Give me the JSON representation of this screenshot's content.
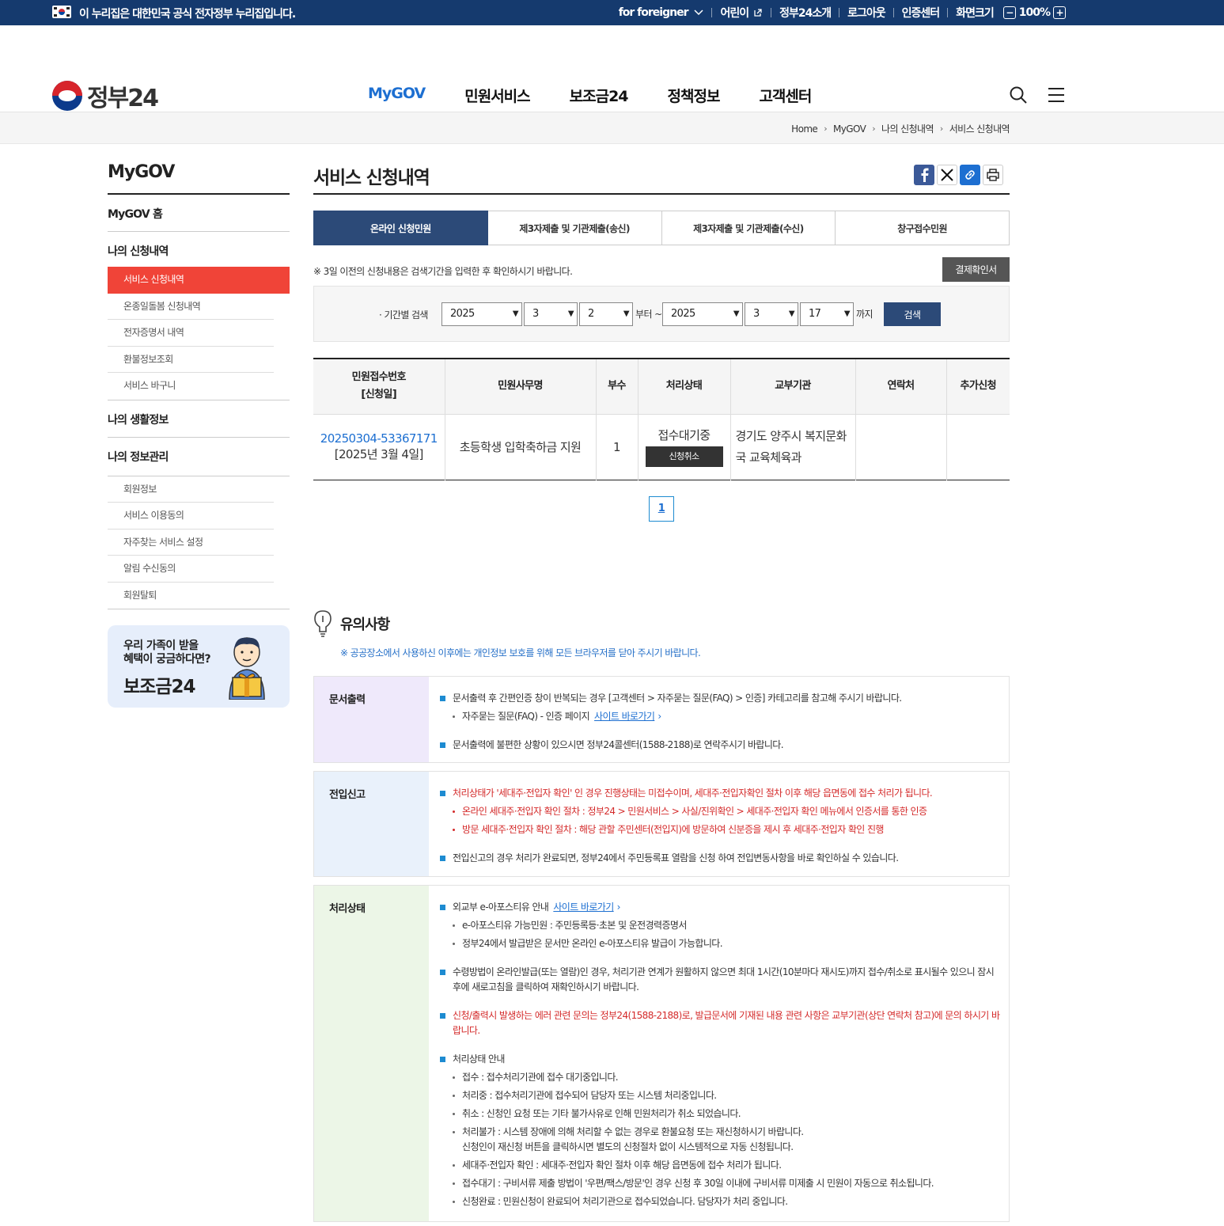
{
  "govbar": {
    "notice": "이 누리집은 대한민국 공식 전자정부 누리집입니다.",
    "foreigner": "for foreigner",
    "links": [
      "어린이",
      "정부24소개",
      "로그아웃",
      "인증센터"
    ],
    "zoom_label": "화면크기",
    "zoom_minus": "−",
    "zoom_value": "100%",
    "zoom_plus": "+"
  },
  "header": {
    "logo_text": "정부24",
    "nav": [
      "MyGOV",
      "민원서비스",
      "보조금24",
      "정책정보",
      "고객센터"
    ]
  },
  "breadcrumb": [
    "Home",
    "MyGOV",
    "나의 신청내역",
    "서비스 신청내역"
  ],
  "lnb": {
    "title": "MyGOV",
    "home": "MyGOV 홈",
    "section1": "나의 신청내역",
    "section1_items": [
      "서비스 신청내역",
      "온종일돌봄 신청내역",
      "전자증명서 내역",
      "환불정보조회",
      "서비스 바구니"
    ],
    "section2": "나의 생활정보",
    "section3": "나의 정보관리",
    "section3_items": [
      "회원정보",
      "서비스 이용동의",
      "자주찾는 서비스 설정",
      "알림 수신동의",
      "회원탈퇴"
    ],
    "banner_line1": "우리 가족이 받을",
    "banner_line2": "혜택이 궁금하다면?",
    "banner_title": "보조금24"
  },
  "content": {
    "title": "서비스 신청내역",
    "tabs": [
      "온라인 신청민원",
      "제3자제출 및 기관제출(송신)",
      "제3자제출 및 기관제출(수신)",
      "창구접수민원"
    ],
    "info_msg": "※ 3일 이전의 신청내용은 검색기간을 입력한 후 확인하시기 바랍니다.",
    "receipt_button": "결제확인서",
    "search": {
      "label": "기간별 검색",
      "from_year": "2025",
      "from_month": "3",
      "from_day": "2",
      "from_text": "부터 ~",
      "to_year": "2025",
      "to_month": "3",
      "to_day": "17",
      "to_text": "까지",
      "button": "검색"
    },
    "table": {
      "headers": [
        "민원접수번호",
        "[신청일]",
        "민원사무명",
        "부수",
        "처리상태",
        "교부기관",
        "연락처",
        "추가신청"
      ],
      "row": {
        "number": "20250304-53367171",
        "date": "[2025년 3월 4일]",
        "name": "초등학생 입학축하금 지원",
        "copies": "1",
        "status": "접수대기중",
        "cancel": "신청취소",
        "agency_line1": "경기도 양주시 복지문화",
        "agency_line2": "국 교육체육과",
        "contact": "",
        "extra": ""
      }
    },
    "page": "1"
  },
  "notice": {
    "title": "유의사항",
    "sub": "※ 공공장소에서 사용하신 이후에는 개인정보 보호를 위해 모든 브라우저를 닫아 주시기 바랍니다.",
    "box1": {
      "label": "문서출력",
      "l1": "문서출력 후 간편인증 창이 반복되는 경우 [고객센터 > 자주묻는 질문(FAQ) > 인증] 카테고리를 참고해 주시기 바랍니다.",
      "l2": "자주묻는 질문(FAQ) - 인증 페이지",
      "l2_link": "사이트 바로가기",
      "l3": "문서출력에 불편한 상황이 있으시면 정부24콜센터(1588-2188)로 연락주시기 바랍니다."
    },
    "box2": {
      "label": "전입신고",
      "l1": "처리상태가 '세대주·전입자 확인' 인 경우 진행상태는 미접수이며, 세대주·전입자확인 절차 이후 해당 읍면동에 접수 처리가 됩니다.",
      "l2": "온라인 세대주·전입자 확인 절차 : 정부24 > 민원서비스 > 사실/진위확인 > 세대주·전입자 확인 메뉴에서 인증서를 통한 인증",
      "l3": "방문 세대주·전입자 확인 절차 : 해당 관할 주민센터(전입지)에 방문하여 신분증을 제시 후 세대주·전입자 확인 진행",
      "l4": "전입신고의 경우 처리가 완료되면, 정부24에서 주민등록표 열람을 신청 하여 전입변동사항을 바로 확인하실 수 있습니다."
    },
    "box3": {
      "label": "처리상태",
      "l1": "외교부 e-아포스티유 안내",
      "l1_link": "사이트 바로가기",
      "l2": "e-아포스티유 가능민원 : 주민등록등·초본 및 운전경력증명서",
      "l3": "정부24에서 발급받은 문서만 온라인 e-아포스티유 발급이 가능합니다.",
      "l4": "수령방법이 온라인발급(또는 열람)인 경우, 처리기관 연계가 원활하지 않으면 최대 1시간(10분마다 재시도)까지 접수/취소로 표시될수 있으니 잠시 후에 새로고침을 클릭하여 재확인하시기 바랍니다.",
      "l5": "신청/출력시 발생하는 에러 관련 문의는 정부24(1588-2188)로, 발급문서에 기재된 내용 관련 사항은 교부기관(상단 연락처 참고)에 문의 하시기 바랍니다.",
      "l6": "처리상태 안내",
      "s1": "접수 : 접수처리기관에 접수 대기중입니다.",
      "s2": "처리중 : 접수처리기관에 접수되어 담당자 또는 시스템 처리중입니다.",
      "s3": "취소 : 신청인 요청 또는 기타 불가사유로 인해 민원처리가 취소 되었습니다.",
      "s4a": "처리불가 : 시스템 장애에 의해 처리할 수 없는 경우로 환불요청 또는 재신청하시기 바랍니다.",
      "s4b": "신청인이 재신청 버튼을 클릭하시면 별도의 신청절차 없이 시스템적으로 자동 신청됩니다.",
      "s5": "세대주·전입자 확인 : 세대주·전입자 확인 절차 이후 해당 읍면동에 접수 처리가 됩니다.",
      "s6": "접수대기 : 구비서류 제출 방법이 '우편/팩스/방문'인 경우 신청 후 30일 이내에 구비서류 미제출 시 민원이 자동으로 취소됩니다.",
      "s7": "신청완료 : 민원신청이 완료되어 처리기관으로 접수되었습니다. 담당자가 처리 중입니다."
    }
  },
  "colors": {
    "govbar": "#153a6e",
    "active_menu": "#f04438",
    "tab_active": "#2c4a78",
    "link": "#1d6fd1",
    "box1_bg": "#efe9fb",
    "box2_bg": "#e9f1fb",
    "box3_bg": "#ecf6e7"
  }
}
